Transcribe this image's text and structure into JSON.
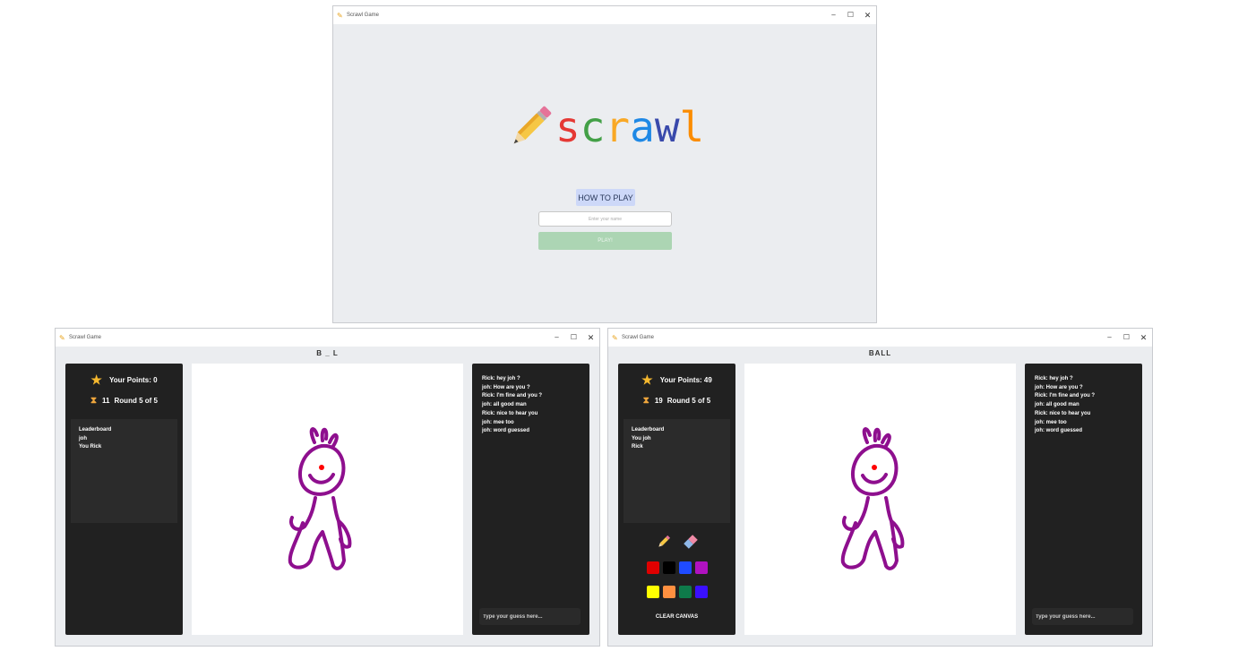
{
  "main_menu": {
    "window_title": "Scrawl Game",
    "logo_letters": [
      {
        "ch": "s",
        "color": "#e53935"
      },
      {
        "ch": "c",
        "color": "#43a047"
      },
      {
        "ch": "r",
        "color": "#f9a825"
      },
      {
        "ch": "a",
        "color": "#1e88e5"
      },
      {
        "ch": "w",
        "color": "#3949ab"
      },
      {
        "ch": "l",
        "color": "#fb8c00"
      }
    ],
    "how_to_play_label": "HOW TO PLAY",
    "name_placeholder": "Enter your name",
    "play_label": "PLAY!"
  },
  "games": [
    {
      "window_title": "Scrawl Game",
      "word": "B _ L",
      "points_label": "Your Points: 0",
      "timer": "11",
      "round_label": "Round 5 of 5",
      "leaderboard_title": "Leaderboard",
      "leaderboard": [
        "joh",
        "You Rick"
      ],
      "chat": [
        "Rick: hey joh ?",
        "joh: How are you ?",
        "Rick: I'm fine and you ?",
        "joh: all good man",
        "Rick: nice to hear you",
        "joh: mee too",
        "joh: word guessed"
      ],
      "guess_placeholder": "Type your guess here...",
      "show_tools": false
    },
    {
      "window_title": "Scrawl Game",
      "word": "BALL",
      "points_label": "Your Points: 49",
      "timer": "19",
      "round_label": "Round 5 of 5",
      "leaderboard_title": "Leaderboard",
      "leaderboard": [
        "You joh",
        "Rick"
      ],
      "chat": [
        "Rick: hey joh ?",
        "joh: How are you ?",
        "Rick: I'm fine and you ?",
        "joh: all good man",
        "Rick: nice to hear you",
        "joh: mee too",
        "joh: word guessed"
      ],
      "guess_placeholder": "Type your guess here...",
      "show_tools": true,
      "clear_label": "CLEAR CANVAS"
    }
  ],
  "palette": [
    "#e00000",
    "#000000",
    "#1f4bff",
    "#b012c0",
    "#ffff00",
    "#ff9040",
    "#0e7a4a",
    "#3a10ff"
  ],
  "drawing_color": "#8e0f8e",
  "nose_color": "#ff0000",
  "icons": {
    "star": "star-icon",
    "hourglass": "hourglass-icon",
    "pencil": "pencil-icon",
    "eraser": "eraser-icon"
  }
}
